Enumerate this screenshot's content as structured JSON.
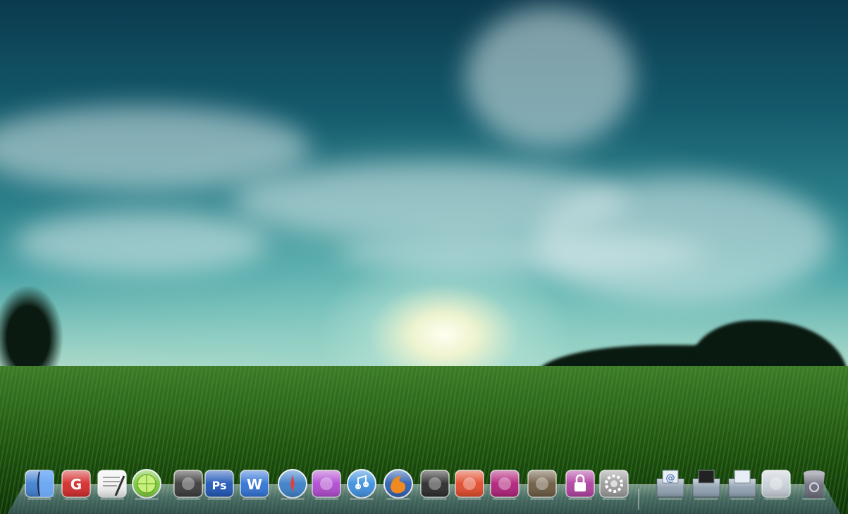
{
  "dock": {
    "apps": [
      {
        "id": "finder",
        "icon": "finder-icon",
        "color": "#3f7fd0"
      },
      {
        "id": "app-g",
        "icon": "g-app-icon",
        "color": "#d42a2a",
        "glyph": "G"
      },
      {
        "id": "textedit",
        "icon": "textedit-icon",
        "color": "#f2f2f2"
      },
      {
        "id": "limewire",
        "icon": "lime-icon",
        "color": "#7ac83a"
      },
      {
        "id": "adium",
        "icon": "ninja-icon",
        "color": "#3a3a3a"
      },
      {
        "id": "photoshop",
        "icon": "photoshop-icon",
        "color": "#1f56b8",
        "glyph": "Ps"
      },
      {
        "id": "word",
        "icon": "word-icon",
        "color": "#2f73d6",
        "glyph": "W"
      },
      {
        "id": "safari",
        "icon": "safari-icon",
        "color": "#3a7fc7"
      },
      {
        "id": "installer",
        "icon": "installer-icon",
        "color": "#b04ad0"
      },
      {
        "id": "itunes",
        "icon": "itunes-icon",
        "color": "#3b8fe0"
      },
      {
        "id": "firefox",
        "icon": "firefox-icon",
        "color": "#2c5fb0"
      },
      {
        "id": "camera-app",
        "icon": "camera-icon",
        "color": "#2a2a2a"
      },
      {
        "id": "toy-gun",
        "icon": "gun-icon",
        "color": "#e24a2a"
      },
      {
        "id": "photo-booth",
        "icon": "photo-booth-icon",
        "color": "#b0207a"
      },
      {
        "id": "gimp",
        "icon": "gimp-icon",
        "color": "#6b5a40"
      },
      {
        "id": "keychain",
        "icon": "lock-icon",
        "color": "#b040a0"
      },
      {
        "id": "system-prefs",
        "icon": "gear-icon",
        "color": "#9a9a9a"
      },
      {
        "id": "mail-folder",
        "icon": "at-folder-icon",
        "color": "#8fa0b0",
        "glyph": "@"
      },
      {
        "id": "downloads",
        "icon": "downloads-folder-icon",
        "color": "#8fa0b0"
      },
      {
        "id": "documents",
        "icon": "documents-folder-icon",
        "color": "#8fa0b0"
      },
      {
        "id": "network",
        "icon": "network-icon",
        "color": "#c8d0d8"
      },
      {
        "id": "trash",
        "icon": "trash-icon",
        "color": "#6a6a78"
      }
    ]
  }
}
